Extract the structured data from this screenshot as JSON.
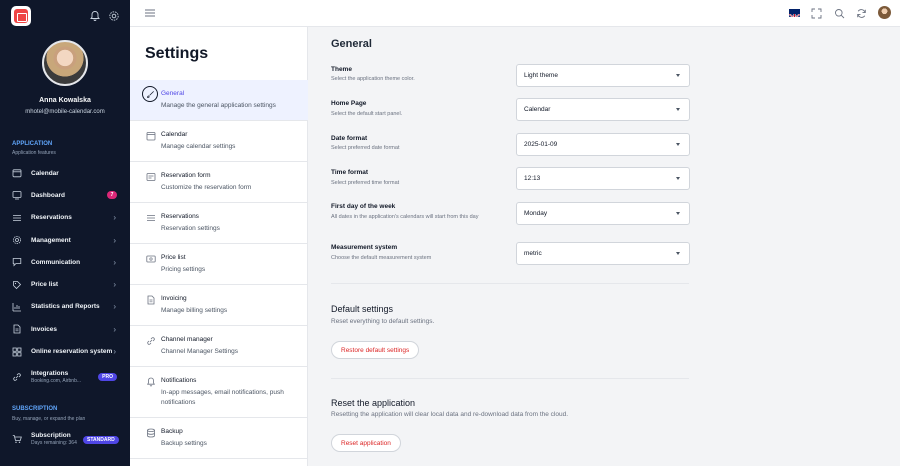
{
  "sidebar": {
    "user_name": "Anna Kowalska",
    "user_email": "mhotel@mobile-calendar.com",
    "application_title": "APPLICATION",
    "application_sub": "Application features",
    "items": [
      {
        "label": "Calendar",
        "icon": "calendar-icon"
      },
      {
        "label": "Dashboard",
        "icon": "dashboard-icon",
        "badge": "7"
      },
      {
        "label": "Reservations",
        "icon": "list-icon"
      },
      {
        "label": "Management",
        "icon": "gear-icon"
      },
      {
        "label": "Communication",
        "icon": "chat-icon"
      },
      {
        "label": "Price list",
        "icon": "price-tag-icon"
      },
      {
        "label": "Statistics and Reports",
        "icon": "chart-icon"
      },
      {
        "label": "Invoices",
        "icon": "document-icon"
      },
      {
        "label": "Online reservation system",
        "icon": "globe-icon"
      }
    ],
    "integrations": {
      "label": "Integrations",
      "sub": "Booking.com, Airbnb...",
      "badge": "PRO"
    },
    "subscription_title": "SUBSCRIPTION",
    "subscription_sub": "Buy, manage, or expand the plan",
    "subscription": {
      "label": "Subscription",
      "sub": "Days remaining: 364",
      "badge": "STANDARD"
    }
  },
  "settings_menu": {
    "title": "Settings",
    "items": [
      {
        "title": "General",
        "desc": "Manage the general application settings",
        "icon": "brush-icon",
        "active": true
      },
      {
        "title": "Calendar",
        "desc": "Manage calendar settings",
        "icon": "calendar-icon"
      },
      {
        "title": "Reservation form",
        "desc": "Customize the reservation form",
        "icon": "form-icon"
      },
      {
        "title": "Reservations",
        "desc": "Reservation settings",
        "icon": "list-icon"
      },
      {
        "title": "Price list",
        "desc": "Pricing settings",
        "icon": "price-list-icon"
      },
      {
        "title": "Invoicing",
        "desc": "Manage billing settings",
        "icon": "invoice-icon"
      },
      {
        "title": "Channel manager",
        "desc": "Channel Manager Settings",
        "icon": "link-icon"
      },
      {
        "title": "Notifications",
        "desc": "In-app messages, email notifications, push notifications",
        "icon": "bell-icon"
      },
      {
        "title": "Backup",
        "desc": "Backup settings",
        "icon": "database-icon"
      }
    ]
  },
  "general": {
    "title": "General",
    "rows": [
      {
        "label": "Theme",
        "desc": "Select the application theme color.",
        "value": "Light theme"
      },
      {
        "label": "Home Page",
        "desc": "Select the default start panel.",
        "value": "Calendar"
      },
      {
        "label": "Date format",
        "desc": "Select preferred date format",
        "value": "2025-01-09"
      },
      {
        "label": "Time format",
        "desc": "Select preferred time format",
        "value": "12:13"
      },
      {
        "label": "First day of the week",
        "desc": "All dates in the application's calendars will start from this day",
        "value": "Monday"
      },
      {
        "label": "Measurement system",
        "desc": "Choose the default measurement system",
        "value": "metric"
      }
    ],
    "default_settings": {
      "heading": "Default settings",
      "desc": "Reset everything to default settings.",
      "button": "Restore default settings"
    },
    "reset_app": {
      "heading": "Reset the application",
      "desc": "Resetting the application will clear local data and re-download data from the cloud.",
      "button": "Reset application"
    }
  }
}
